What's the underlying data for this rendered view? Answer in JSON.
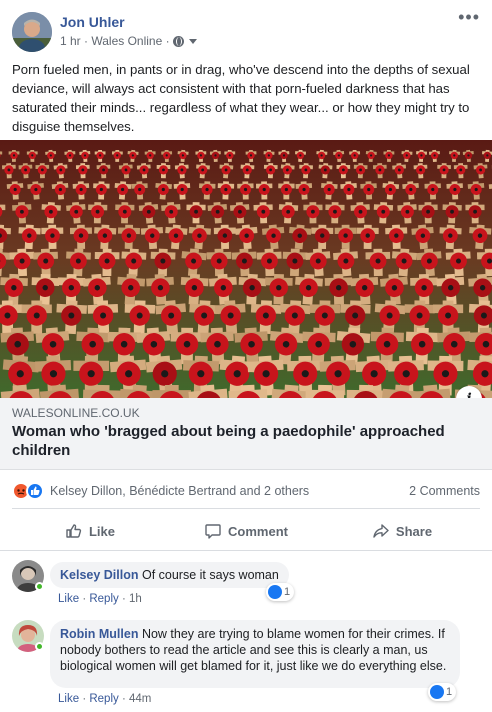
{
  "post": {
    "author": "Jon Uhler",
    "meta": "1 hr · Wales Online ·",
    "more_label": "•••",
    "text": "Porn fueled men, in pants or in drag, who've descend into the depths of sexual deviance, will always act consistent with that porn-fueled darkness that has saturated their minds... regardless of what they wear... or how they might try to disguise themselves."
  },
  "link": {
    "info_label": "i",
    "domain": "WALESONLINE.CO.UK",
    "title": "Woman who 'bragged about being a paedophile' approached children"
  },
  "reactions": {
    "names": "Kelsey Dillon, Bénédicte Bertrand and 2 others",
    "comments_count": "2 Comments"
  },
  "actions": {
    "like": "Like",
    "comment": "Comment",
    "share": "Share"
  },
  "comments": [
    {
      "author": "Kelsey Dillon",
      "text": "Of course it says woman",
      "like": "Like",
      "reply": "Reply",
      "time": "1h",
      "reaction_count": "1"
    },
    {
      "author": "Robin Mullen",
      "text": "Now they are trying to blame women for their crimes. If nobody bothers to read the article and see this is clearly a man, us biological women will get blamed for it, just like we do everything else.",
      "like": "Like",
      "reply": "Reply",
      "time": "44m",
      "reaction_count": "1"
    }
  ],
  "colors": {
    "link_blue": "#385898",
    "secondary_text": "#606770",
    "like_blue": "#1877f2",
    "angry_orange": "#f0582e",
    "online_green": "#42b72a"
  },
  "icons": [
    "globe-icon",
    "caret-down-icon",
    "more-icon",
    "info-icon",
    "angry-reaction-icon",
    "like-reaction-icon",
    "thumbs-up-icon",
    "comment-icon",
    "share-icon"
  ]
}
